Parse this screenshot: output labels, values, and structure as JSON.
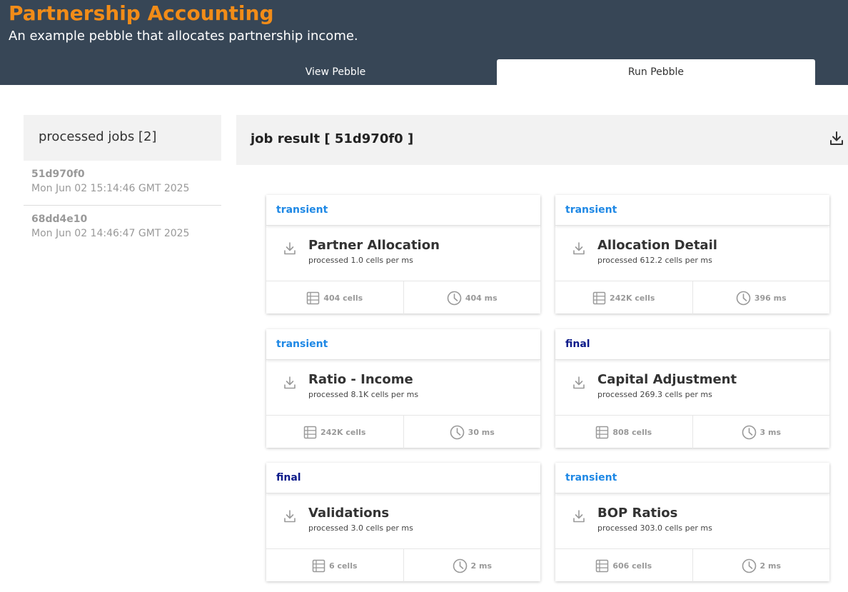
{
  "header": {
    "title": "Partnership Accounting",
    "subtitle": "An example pebble that allocates partnership income.",
    "tabs": [
      {
        "label": "View Pebble",
        "active": false
      },
      {
        "label": "Run Pebble",
        "active": true
      }
    ]
  },
  "jobs_panel": {
    "title": "processed jobs [2]",
    "jobs": [
      {
        "id": "51d970f0",
        "time": "Mon Jun 02 15:14:46 GMT 2025"
      },
      {
        "id": "68dd4e10",
        "time": "Mon Jun 02 14:46:47 GMT 2025"
      }
    ]
  },
  "result": {
    "title": "job result [ 51d970f0 ]",
    "download_icon": "download-icon"
  },
  "cards": [
    {
      "tag": "transient",
      "name": "Partner Allocation",
      "rate": "processed 1.0 cells per ms",
      "cells": "404 cells",
      "time": "404 ms"
    },
    {
      "tag": "transient",
      "name": "Allocation Detail",
      "rate": "processed 612.2 cells per ms",
      "cells": "242K cells",
      "time": "396 ms"
    },
    {
      "tag": "transient",
      "name": "Ratio - Income",
      "rate": "processed 8.1K cells per ms",
      "cells": "242K cells",
      "time": "30 ms"
    },
    {
      "tag": "final",
      "name": "Capital Adjustment",
      "rate": "processed 269.3 cells per ms",
      "cells": "808 cells",
      "time": "3 ms"
    },
    {
      "tag": "final",
      "name": "Validations",
      "rate": "processed 3.0 cells per ms",
      "cells": "6 cells",
      "time": "2 ms"
    },
    {
      "tag": "transient",
      "name": "BOP Ratios",
      "rate": "processed 303.0 cells per ms",
      "cells": "606 cells",
      "time": "2 ms"
    }
  ],
  "colors": {
    "header_bg": "#374656",
    "title": "#f28c18",
    "transient": "#1e88e5",
    "final": "#0d1b8a"
  }
}
